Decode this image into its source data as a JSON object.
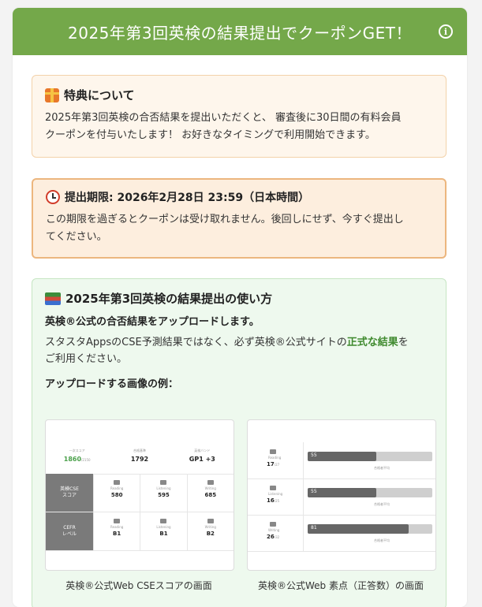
{
  "header": {
    "title": "2025年第3回英検の結果提出でクーポンGET！",
    "info_icon": "i"
  },
  "benefit": {
    "icon": "gift-icon",
    "title": "特典について",
    "lines": [
      "2025年第3回英検の合否結果を提出いただくと、 審査後に30日間の有料会員",
      "クーポンを付与いたします！ お好きなタイミングで利用開始できます。"
    ]
  },
  "deadline": {
    "icon": "alarm-clock-icon",
    "title": "提出期限: 2026年2月28日 23:59（日本時間）",
    "lines": [
      "この期限を過ぎるとクーポンは受け取れません。後回しにせず、今すぐ提出し",
      "てください。"
    ]
  },
  "howto": {
    "icon": "books-icon",
    "title": "2025年第3回英検の結果提出の使い方",
    "subhead": "英検®公式の合否結果をアップロードします。",
    "desc_pre": "スタスタAppsのCSE予測結果ではなく、必ず英検®公式サイトの",
    "desc_hl": "正式な結果",
    "desc_post": "を",
    "desc_line2": "ご利用ください。",
    "example_label": "アップロードする画像の例：",
    "examples": [
      {
        "caption": "英検®公式Web CSEスコアの画面",
        "top": [
          {
            "label": "一次スコア",
            "value": "1860",
            "suffix": "/2150"
          },
          {
            "label": "合格基準",
            "value": "1792"
          },
          {
            "label": "英検バンド",
            "value": "GP1 +3"
          }
        ],
        "rows": [
          {
            "side": "英検CSE\nスコア",
            "cells": [
              {
                "label": "Reading",
                "value": "580"
              },
              {
                "label": "Listening",
                "value": "595"
              },
              {
                "label": "Writing",
                "value": "685"
              }
            ]
          },
          {
            "side": "CEFR\nレベル",
            "cells": [
              {
                "label": "Reading",
                "value": "B1"
              },
              {
                "label": "Listening",
                "value": "B1"
              },
              {
                "label": "Writing",
                "value": "B2"
              }
            ]
          }
        ]
      },
      {
        "caption": "英検®公式Web 素点（正答数）の画面",
        "rows": [
          {
            "label": "Reading",
            "value": "17",
            "suffix": "/27",
            "bar": "55",
            "fill": 0.55,
            "tag": "合格者平均"
          },
          {
            "label": "Listening",
            "value": "16",
            "suffix": "/25",
            "bar": "55",
            "fill": 0.55,
            "tag": "合格者平均"
          },
          {
            "label": "Writing",
            "value": "26",
            "suffix": "/32",
            "bar": "81",
            "fill": 0.81,
            "tag": "合格者平均"
          }
        ]
      }
    ]
  },
  "colors": {
    "header": "#74a84a",
    "benefit_bg": "#fef6ec",
    "deadline_border": "#ecb67e",
    "howto_bg": "#eef9ee",
    "highlight": "#3f8a2e"
  }
}
